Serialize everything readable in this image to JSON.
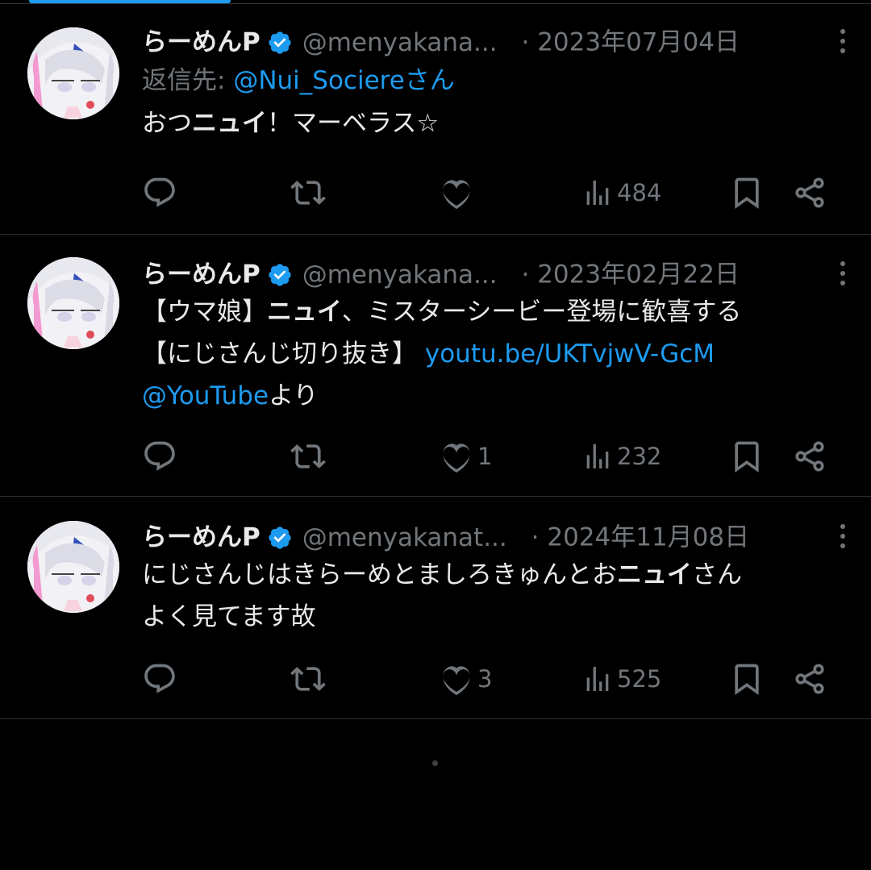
{
  "tweets": [
    {
      "name": "らーめんP",
      "handle": "@menyakana...",
      "dot": "·",
      "date": "2023年07月04日",
      "reply_prefix": "返信先: ",
      "reply_mention": "@Nui_Sociereさん",
      "body_parts": [
        {
          "t": "おつ"
        },
        {
          "t": "ニュイ",
          "style": "bold"
        },
        {
          "t": "！マーベラス☆"
        }
      ],
      "stats": {
        "replies": "",
        "retweets": "",
        "likes": "",
        "views": "484"
      }
    },
    {
      "name": "らーめんP",
      "handle": "@menyakana...",
      "dot": "·",
      "date": "2023年02月22日",
      "body_parts": [
        {
          "t": "【ウマ娘】"
        },
        {
          "t": "ニュイ",
          "style": "bold"
        },
        {
          "t": "、ミスターシービー登場に歓喜する\n【にじさんじ切り抜き】 "
        },
        {
          "t": "youtu.be/UKTvjwV-GcM",
          "style": "link"
        },
        {
          "t": "\n"
        },
        {
          "t": "@YouTube",
          "style": "link"
        },
        {
          "t": "より"
        }
      ],
      "stats": {
        "replies": "",
        "retweets": "",
        "likes": "1",
        "views": "232"
      }
    },
    {
      "name": "らーめんP",
      "handle": "@menyakanat...",
      "dot": "·",
      "date": "2024年11月08日",
      "body_parts": [
        {
          "t": "にじさんじはきらーめとましろきゅんとお"
        },
        {
          "t": "ニュイ",
          "style": "bold"
        },
        {
          "t": "さん\nよく見てます故"
        }
      ],
      "stats": {
        "replies": "",
        "retweets": "",
        "likes": "3",
        "views": "525"
      }
    }
  ],
  "colors": {
    "background": "#000000",
    "text": "#e7e9ea",
    "secondary": "#71767b",
    "accent": "#1d9bf0",
    "divider": "#2f3336"
  },
  "icons": {
    "verified": "verified-badge-icon",
    "more": "more-vertical-icon",
    "reply": "reply-icon",
    "retweet": "retweet-icon",
    "like": "heart-icon",
    "views": "views-icon",
    "bookmark": "bookmark-icon",
    "share": "share-icon"
  }
}
